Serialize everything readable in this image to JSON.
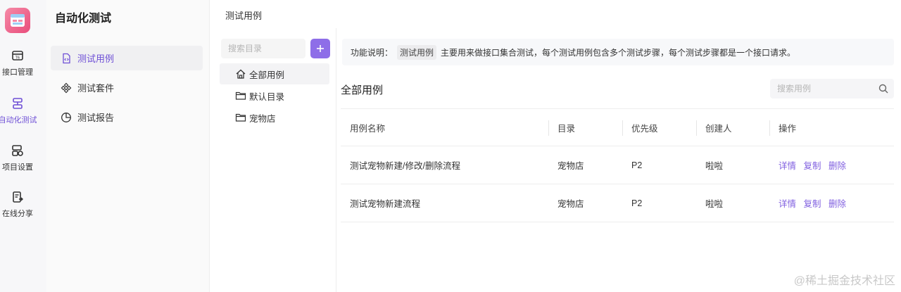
{
  "rail": {
    "items": [
      {
        "label": "接口管理"
      },
      {
        "label": "自动化测试"
      },
      {
        "label": "项目设置"
      },
      {
        "label": "在线分享"
      }
    ]
  },
  "subnav": {
    "title": "自动化测试",
    "items": [
      {
        "label": "测试用例"
      },
      {
        "label": "测试套件"
      },
      {
        "label": "测试报告"
      }
    ]
  },
  "header": {
    "title": "测试用例"
  },
  "tree": {
    "search_placeholder": "搜索目录",
    "items": [
      {
        "label": "全部用例"
      },
      {
        "label": "默认目录"
      },
      {
        "label": "宠物店"
      }
    ]
  },
  "main": {
    "notice": {
      "prefix": "功能说明：",
      "tag": "测试用例",
      "text": "主要用来做接口集合测试，每个测试用例包含多个测试步骤，每个测试步骤都是一个接口请求。"
    },
    "list_title": "全部用例",
    "search_placeholder": "搜索用例",
    "table": {
      "columns": [
        "用例名称",
        "目录",
        "优先级",
        "创建人",
        "操作"
      ],
      "rows": [
        {
          "name": "测试宠物新建/修改/删除流程",
          "dir": "宠物店",
          "priority": "P2",
          "creator": "啦啦",
          "ops": [
            "详情",
            "复制",
            "删除"
          ]
        },
        {
          "name": "测试宠物新建流程",
          "dir": "宠物店",
          "priority": "P2",
          "creator": "啦啦",
          "ops": [
            "详情",
            "复制",
            "删除"
          ]
        }
      ]
    }
  },
  "watermark": "@稀土掘金技术社区",
  "colors": {
    "accent": "#8e6ee8",
    "link": "#8160e0",
    "logo": "#e94d7c"
  }
}
